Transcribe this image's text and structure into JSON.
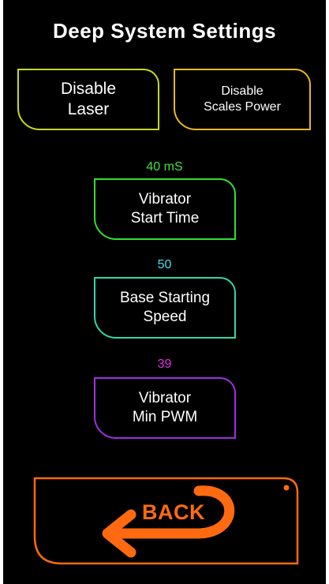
{
  "title": "Deep System Settings",
  "buttons": {
    "disable_laser": "Disable\nLaser",
    "disable_scales_power": "Disable\nScales Power",
    "vibrator_start_time": "Vibrator\nStart Time",
    "base_starting_speed": "Base Starting\nSpeed",
    "vibrator_min_pwm": "Vibrator\nMin PWM",
    "back": "BACK"
  },
  "values": {
    "vibrator_start_time": "40 mS",
    "base_starting_speed": "50",
    "vibrator_min_pwm": "39"
  },
  "colors": {
    "disable_laser_border": "#c8d820",
    "disable_scales_border": "#e8b820",
    "vibrator_start_border": "#30e030",
    "vibrator_start_value": "#40e040",
    "base_speed_border": "#30d8a8",
    "base_speed_value": "#40e0f0",
    "min_pwm_border": "#a030e0",
    "min_pwm_value": "#e030e0",
    "back": "#ff6a10"
  },
  "icons": {
    "back": "curved-arrow-left-icon"
  }
}
